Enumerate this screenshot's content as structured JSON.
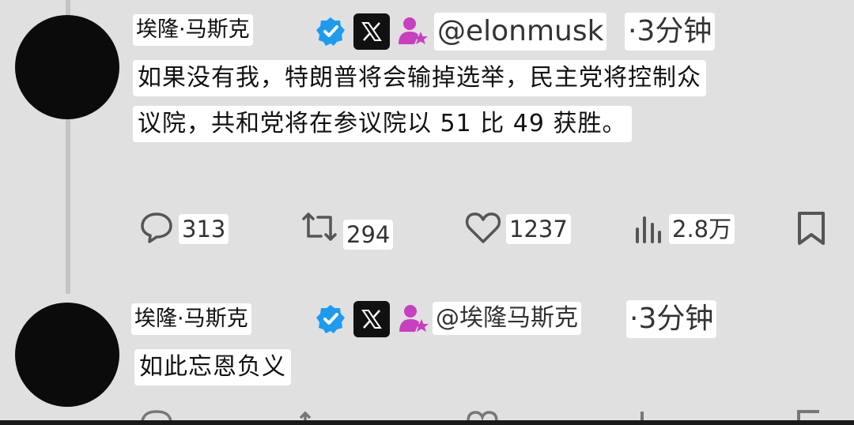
{
  "tweets": [
    {
      "name": "埃隆·马斯克",
      "handle": "@elonmusk",
      "time": "·3分钟",
      "text_lines": [
        "如果没有我，特朗普将会输掉选举，民主党将控制众",
        "议院，共和党将在参议院以 51 比 49 获胜。"
      ],
      "stats": {
        "replies": "313",
        "retweets": "294",
        "likes": "1237",
        "views": "2.8万"
      }
    },
    {
      "name": "埃隆·马斯克",
      "handle": "@埃隆马斯克",
      "time": "·3分钟",
      "text_lines": [
        "如此忘恩负义"
      ]
    }
  ],
  "colors": {
    "verified": "#1d9bf0",
    "badge_pink": "#c83fc0",
    "background": "#e0e0e0"
  },
  "icons": [
    "verified-icon",
    "x-logo-icon",
    "user-star-icon",
    "reply-icon",
    "retweet-icon",
    "like-icon",
    "views-icon",
    "bookmark-icon"
  ]
}
